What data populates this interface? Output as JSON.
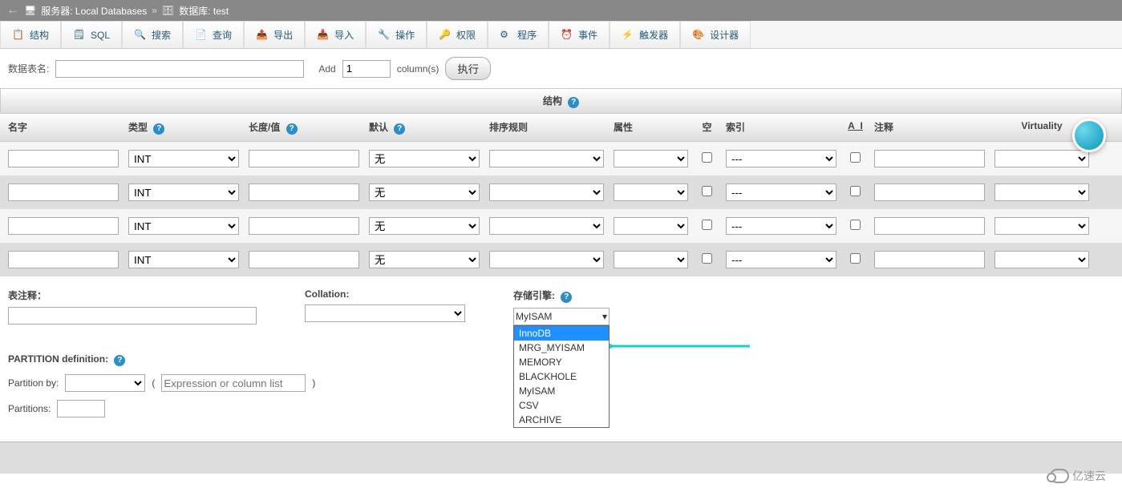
{
  "breadcrumb": {
    "server_icon": "server-icon",
    "server_label": "服务器: Local Databases",
    "sep": "»",
    "db_icon": "db-icon",
    "db_label": "数据库: test"
  },
  "tabs": [
    {
      "icon": "structure",
      "label": "结构"
    },
    {
      "icon": "sql",
      "label": "SQL"
    },
    {
      "icon": "search",
      "label": "搜索"
    },
    {
      "icon": "query",
      "label": "查询"
    },
    {
      "icon": "export",
      "label": "导出"
    },
    {
      "icon": "import",
      "label": "导入"
    },
    {
      "icon": "operations",
      "label": "操作"
    },
    {
      "icon": "privileges",
      "label": "权限"
    },
    {
      "icon": "routines",
      "label": "程序"
    },
    {
      "icon": "events",
      "label": "事件"
    },
    {
      "icon": "triggers",
      "label": "触发器"
    },
    {
      "icon": "designer",
      "label": "设计器"
    }
  ],
  "form": {
    "table_name_label": "数据表名:",
    "table_name_value": "",
    "add_label": "Add",
    "add_value": "1",
    "columns_label": "column(s)",
    "execute_label": "执行"
  },
  "structure_header": "结构",
  "columns": {
    "name": "名字",
    "type": "类型",
    "length": "长度/值",
    "default": "默认",
    "collation": "排序规则",
    "attributes": "属性",
    "null": "空",
    "index": "索引",
    "ai": "A_I",
    "comments": "注释",
    "virtuality": "Virtuality"
  },
  "rows": [
    {
      "name": "",
      "type": "INT",
      "length": "",
      "default": "无",
      "collation": "",
      "attributes": "",
      "null": false,
      "index": "---",
      "ai": false,
      "comments": "",
      "virtuality": ""
    },
    {
      "name": "",
      "type": "INT",
      "length": "",
      "default": "无",
      "collation": "",
      "attributes": "",
      "null": false,
      "index": "---",
      "ai": false,
      "comments": "",
      "virtuality": ""
    },
    {
      "name": "",
      "type": "INT",
      "length": "",
      "default": "无",
      "collation": "",
      "attributes": "",
      "null": false,
      "index": "---",
      "ai": false,
      "comments": "",
      "virtuality": ""
    },
    {
      "name": "",
      "type": "INT",
      "length": "",
      "default": "无",
      "collation": "",
      "attributes": "",
      "null": false,
      "index": "---",
      "ai": false,
      "comments": "",
      "virtuality": ""
    }
  ],
  "bottom": {
    "table_comments_label": "表注释：",
    "table_comments_value": "",
    "collation_label": "Collation:",
    "collation_value": "",
    "engine_label": "存储引擎:",
    "engine_selected": "MyISAM",
    "engine_options": [
      "InnoDB",
      "MRG_MYISAM",
      "MEMORY",
      "BLACKHOLE",
      "MyISAM",
      "CSV",
      "ARCHIVE"
    ],
    "engine_highlighted": "InnoDB"
  },
  "partition": {
    "title": "PARTITION definition:",
    "by_label": "Partition by:",
    "by_value": "",
    "expr_placeholder": "Expression or column list",
    "expr_value": "",
    "partitions_label": "Partitions:",
    "partitions_value": ""
  },
  "watermark": "亿速云"
}
